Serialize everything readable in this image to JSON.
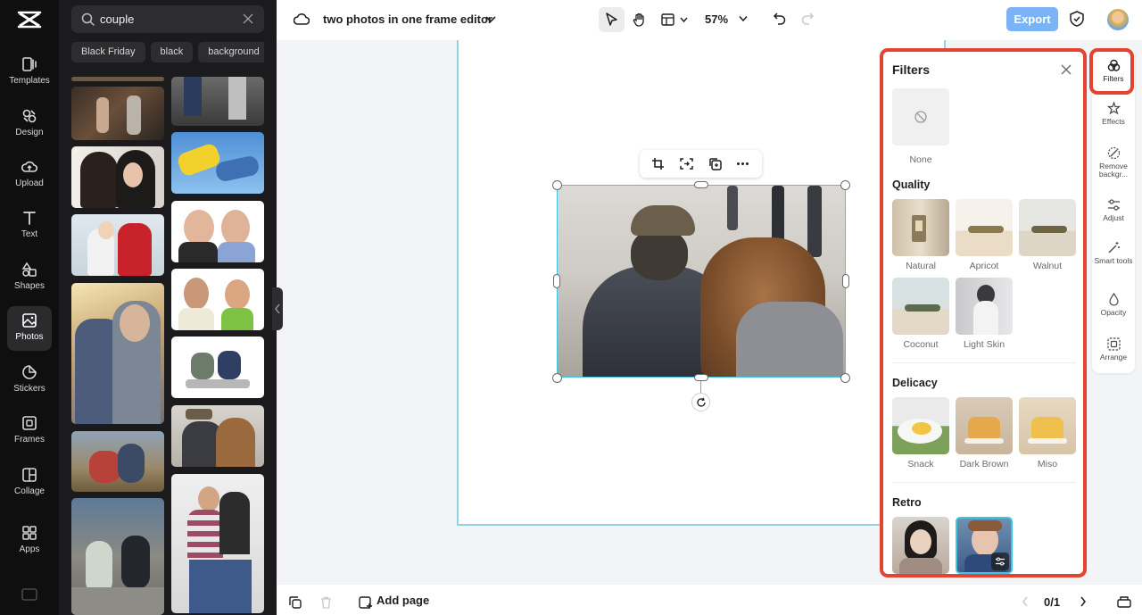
{
  "rail": {
    "items": [
      {
        "label": "Templates",
        "icon": "templates-icon"
      },
      {
        "label": "Design",
        "icon": "design-icon"
      },
      {
        "label": "Upload",
        "icon": "upload-icon"
      },
      {
        "label": "Text",
        "icon": "text-icon"
      },
      {
        "label": "Shapes",
        "icon": "shapes-icon"
      },
      {
        "label": "Photos",
        "icon": "photos-icon"
      },
      {
        "label": "Stickers",
        "icon": "stickers-icon"
      },
      {
        "label": "Frames",
        "icon": "frames-icon"
      },
      {
        "label": "Collage",
        "icon": "collage-icon"
      },
      {
        "label": "Apps",
        "icon": "apps-icon"
      }
    ],
    "active": "Photos"
  },
  "library": {
    "search_value": "couple",
    "chips": [
      "Black Friday",
      "black",
      "background"
    ]
  },
  "topbar": {
    "title": "two photos in one frame editor",
    "zoom": "57%",
    "export_label": "Export"
  },
  "bottombar": {
    "add_page_label": "Add page",
    "page_indicator": "0/1"
  },
  "filters": {
    "title": "Filters",
    "none_label": "None",
    "sections": {
      "quality": {
        "title": "Quality",
        "items": [
          "Natural",
          "Apricot",
          "Walnut",
          "Coconut",
          "Light Skin"
        ]
      },
      "delicacy": {
        "title": "Delicacy",
        "items": [
          "Snack",
          "Dark Brown",
          "Miso"
        ]
      },
      "retro": {
        "title": "Retro"
      }
    }
  },
  "properties": {
    "items": [
      "Filters",
      "Effects",
      "Remove backgr...",
      "Adjust",
      "Smart tools",
      "Opacity",
      "Arrange"
    ]
  },
  "colors": {
    "accent_export": "#7bb4f6",
    "highlight_red": "#e24431",
    "selection_cyan": "#3ec7de"
  }
}
